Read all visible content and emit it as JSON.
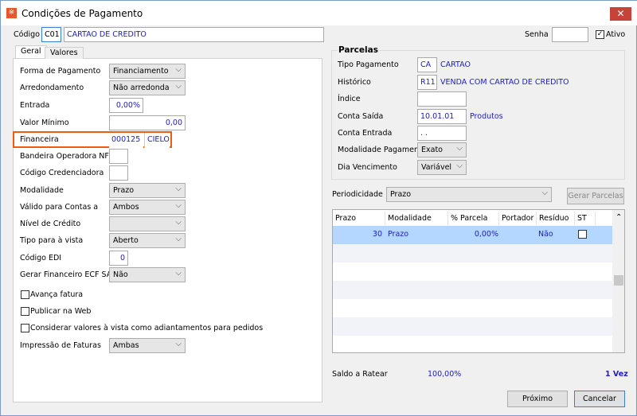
{
  "window": {
    "title": "Condições de Pagamento",
    "close": "✕",
    "icon": "※"
  },
  "codigo": {
    "label": "Código",
    "code": "C01",
    "name": "CARTAO DE CREDITO"
  },
  "senha": {
    "label": "Senha",
    "value": ""
  },
  "ativo": {
    "label": "Ativo",
    "checked": true,
    "mark": "✓"
  },
  "tabs": [
    "Geral",
    "Valores"
  ],
  "geral": {
    "forma_pagamento": {
      "label": "Forma de Pagamento",
      "value": "Financiamento"
    },
    "arredondamento": {
      "label": "Arredondamento",
      "value": "Não arredonda"
    },
    "entrada": {
      "label": "Entrada",
      "value": "0,00%"
    },
    "valor_minimo": {
      "label": "Valor Mínimo",
      "value": "0,00"
    },
    "financeira": {
      "label": "Financeira",
      "code": "000125",
      "name": "CIELO"
    },
    "bandeira": {
      "label": "Bandeira Operadora NFC-e",
      "value": ""
    },
    "credenciadora": {
      "label": "Código Credenciadora",
      "value": ""
    },
    "modalidade": {
      "label": "Modalidade",
      "value": "Prazo"
    },
    "valido_contas": {
      "label": "Válido para Contas a",
      "value": "Ambos"
    },
    "nivel_credito": {
      "label": "Nível de Crédito",
      "value": ""
    },
    "tipo_vista": {
      "label": "Tipo para à vista",
      "value": "Aberto"
    },
    "codigo_edi": {
      "label": "Código EDI",
      "value": "0"
    },
    "gerar_financeiro": {
      "label": "Gerar Financeiro ECF SAC",
      "value": "Não"
    },
    "avanca_fatura": {
      "label": "Avança fatura",
      "checked": false
    },
    "publicar_web": {
      "label": "Publicar na Web",
      "checked": false
    },
    "considerar_valores": {
      "label": "Considerar valores à vista como adiantamentos para pedidos",
      "checked": false
    },
    "impressao_faturas": {
      "label": "Impressão de Faturas",
      "value": "Ambas"
    }
  },
  "parcelas": {
    "title": "Parcelas",
    "tipo_pagamento": {
      "label": "Tipo Pagamento",
      "code": "CA",
      "name": "CARTAO"
    },
    "historico": {
      "label": "Histórico",
      "code": "R11",
      "name": "VENDA COM CARTAO DE CREDITO"
    },
    "indice": {
      "label": "Índice",
      "value": ""
    },
    "conta_saida": {
      "label": "Conta Saída",
      "value": "10.01.01",
      "name": "Produtos"
    },
    "conta_entrada": {
      "label": "Conta Entrada",
      "value": ". ."
    },
    "modalidade_pagamento": {
      "label": "Modalidade Pagamento",
      "value": "Exato"
    },
    "dia_vencimento": {
      "label": "Dia Vencimento",
      "value": "Variável"
    }
  },
  "periodicidade": {
    "label": "Periodicidade",
    "value": "Prazo",
    "gerar": "Gerar Parcelas"
  },
  "grid": {
    "columns": [
      "Prazo",
      "Modalidade",
      "% Parcela",
      "Portador",
      "Resíduo",
      "ST"
    ],
    "rows": [
      {
        "prazo": "30",
        "modalidade": "Prazo",
        "parcela": "0,00%",
        "portador": "",
        "residuo": "Não",
        "st": false
      }
    ],
    "scroll_up": "⌃"
  },
  "saldo": {
    "label": "Saldo a Ratear",
    "value": "100,00%",
    "vezes": "1 Vez"
  },
  "buttons": {
    "proximo": "Próximo",
    "cancelar": "Cancelar"
  }
}
